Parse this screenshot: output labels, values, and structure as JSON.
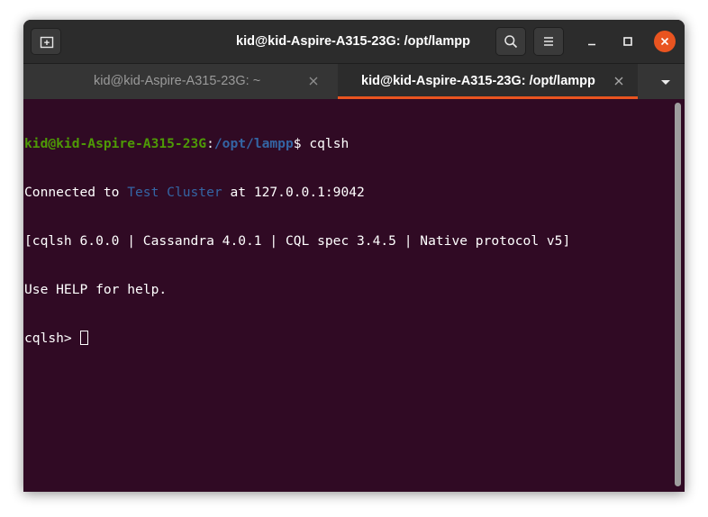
{
  "window": {
    "title": "kid@kid-Aspire-A315-23G: /opt/lampp"
  },
  "titlebar": {
    "new_tab_icon": "new-tab-icon",
    "search_icon": "search-icon",
    "menu_icon": "hamburger-menu-icon",
    "minimize_icon": "minimize-icon",
    "maximize_icon": "maximize-icon",
    "close_icon": "close-icon"
  },
  "tabs": [
    {
      "label": "kid@kid-Aspire-A315-23G: ~",
      "active": false
    },
    {
      "label": "kid@kid-Aspire-A315-23G: /opt/lampp",
      "active": true
    }
  ],
  "terminal": {
    "prompt_user_host": "kid@kid-Aspire-A315-23G",
    "prompt_colon": ":",
    "prompt_path": "/opt/lampp",
    "prompt_symbol": "$",
    "command": " cqlsh",
    "connected_prefix": "Connected to ",
    "cluster_name": "Test Cluster",
    "connected_suffix": " at 127.0.0.1:9042",
    "version_line": "[cqlsh 6.0.0 | Cassandra 4.0.1 | CQL spec 3.4.5 | Native protocol v5]",
    "help_line": "Use HELP for help.",
    "cqlsh_prompt": "cqlsh> "
  },
  "colors": {
    "terminal_bg": "#300a24",
    "user_host": "#4e9a06",
    "path": "#3465a4",
    "accent": "#e95420"
  }
}
